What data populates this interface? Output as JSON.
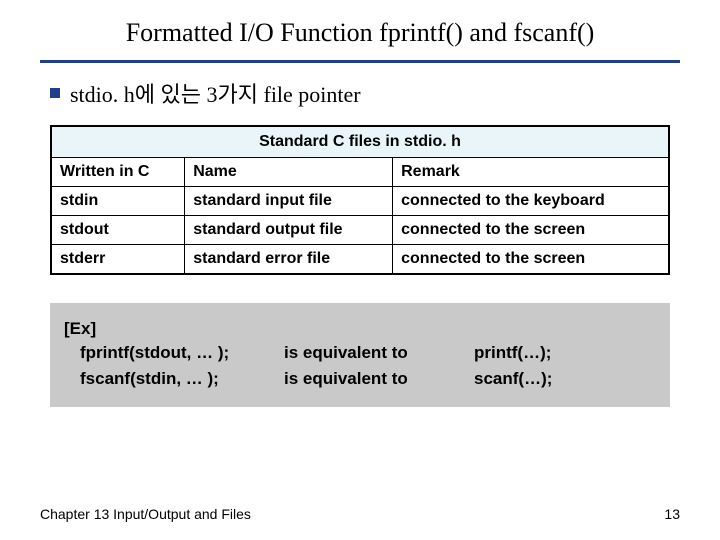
{
  "title": "Formatted I/O Function fprintf() and fscanf()",
  "bullet": "stdio. h에 있는 3가지 file pointer",
  "table": {
    "caption": "Standard C files in stdio. h",
    "headers": [
      "Written in C",
      "Name",
      "Remark"
    ],
    "rows": [
      [
        "stdin",
        "standard input file",
        "connected to the keyboard"
      ],
      [
        "stdout",
        "standard output file",
        "connected to the screen"
      ],
      [
        "stderr",
        "standard error file",
        "connected to the screen"
      ]
    ]
  },
  "example": {
    "label": "[Ex]",
    "rows": [
      {
        "code": "fprintf(stdout, … );",
        "mid": "is equivalent to",
        "equiv": "printf(…);"
      },
      {
        "code": "fscanf(stdin, … );",
        "mid": "is equivalent to",
        "equiv": "scanf(…);"
      }
    ]
  },
  "footer": {
    "left": "Chapter 13  Input/Output and Files",
    "right": "13"
  },
  "colors": {
    "accent": "#1f3f8a",
    "tableHeaderBg": "#e9f5f9",
    "exBg": "#c9c9c9"
  },
  "chart_data": {
    "type": "table",
    "title": "Standard C files in stdio. h",
    "columns": [
      "Written in C",
      "Name",
      "Remark"
    ],
    "rows": [
      [
        "stdin",
        "standard input file",
        "connected to the keyboard"
      ],
      [
        "stdout",
        "standard output file",
        "connected to the screen"
      ],
      [
        "stderr",
        "standard error file",
        "connected to the screen"
      ]
    ]
  }
}
